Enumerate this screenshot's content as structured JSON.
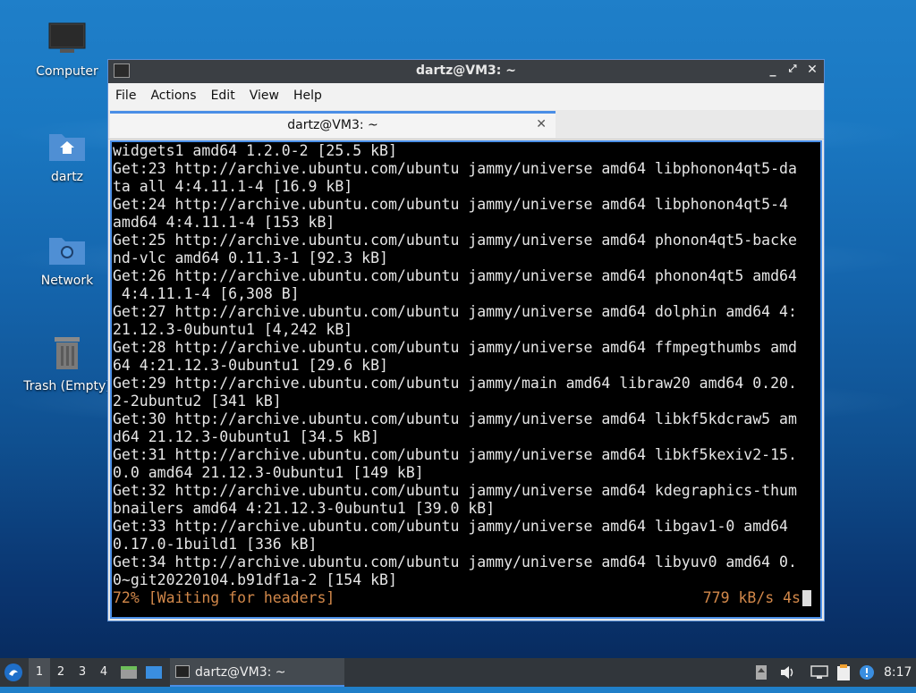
{
  "desktop": {
    "icons": [
      {
        "label": "Computer"
      },
      {
        "label": "dartz"
      },
      {
        "label": "Network"
      },
      {
        "label": "Trash (Empty)"
      }
    ]
  },
  "window": {
    "title": "dartz@VM3: ~",
    "menu": [
      "File",
      "Actions",
      "Edit",
      "View",
      "Help"
    ],
    "tab_label": "dartz@VM3: ~"
  },
  "terminal": {
    "lines": [
      "widgets1 amd64 1.2.0-2 [25.5 kB]",
      "Get:23 http://archive.ubuntu.com/ubuntu jammy/universe amd64 libphonon4qt5-da",
      "ta all 4:4.11.1-4 [16.9 kB]",
      "Get:24 http://archive.ubuntu.com/ubuntu jammy/universe amd64 libphonon4qt5-4",
      "amd64 4:4.11.1-4 [153 kB]",
      "Get:25 http://archive.ubuntu.com/ubuntu jammy/universe amd64 phonon4qt5-backe",
      "nd-vlc amd64 0.11.3-1 [92.3 kB]",
      "Get:26 http://archive.ubuntu.com/ubuntu jammy/universe amd64 phonon4qt5 amd64",
      " 4:4.11.1-4 [6,308 B]",
      "Get:27 http://archive.ubuntu.com/ubuntu jammy/universe amd64 dolphin amd64 4:",
      "21.12.3-0ubuntu1 [4,242 kB]",
      "Get:28 http://archive.ubuntu.com/ubuntu jammy/universe amd64 ffmpegthumbs amd",
      "64 4:21.12.3-0ubuntu1 [29.6 kB]",
      "Get:29 http://archive.ubuntu.com/ubuntu jammy/main amd64 libraw20 amd64 0.20.",
      "2-2ubuntu2 [341 kB]",
      "Get:30 http://archive.ubuntu.com/ubuntu jammy/universe amd64 libkf5kdcraw5 am",
      "d64 21.12.3-0ubuntu1 [34.5 kB]",
      "Get:31 http://archive.ubuntu.com/ubuntu jammy/universe amd64 libkf5kexiv2-15.",
      "0.0 amd64 21.12.3-0ubuntu1 [149 kB]",
      "Get:32 http://archive.ubuntu.com/ubuntu jammy/universe amd64 kdegraphics-thum",
      "bnailers amd64 4:21.12.3-0ubuntu1 [39.0 kB]",
      "Get:33 http://archive.ubuntu.com/ubuntu jammy/universe amd64 libgav1-0 amd64",
      "0.17.0-1build1 [336 kB]",
      "Get:34 http://archive.ubuntu.com/ubuntu jammy/universe amd64 libyuv0 amd64 0.",
      "0~git20220104.b91df1a-2 [154 kB]"
    ],
    "status_text": "72% [Waiting for headers]",
    "rate_text": "779 kB/s 4s",
    "status_color": "#d2884a"
  },
  "taskbar": {
    "workspaces": [
      "1",
      "2",
      "3",
      "4"
    ],
    "active_workspace": "1",
    "task_label": "dartz@VM3: ~",
    "clock": "8:17"
  }
}
